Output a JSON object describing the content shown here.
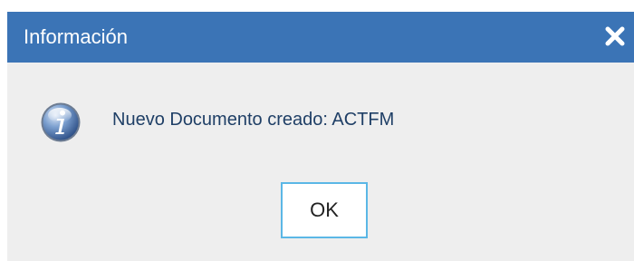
{
  "dialog": {
    "title": "Información",
    "close_icon": "close-icon",
    "icon": "info-icon",
    "message": "Nuevo Documento creado: ACTFM",
    "ok_label": "OK"
  },
  "colors": {
    "titlebar": "#3b74b6",
    "title_text": "#ffffff",
    "body_bg": "#eeeeee",
    "message_text": "#1f3f66",
    "ok_border": "#5bb7e6"
  }
}
